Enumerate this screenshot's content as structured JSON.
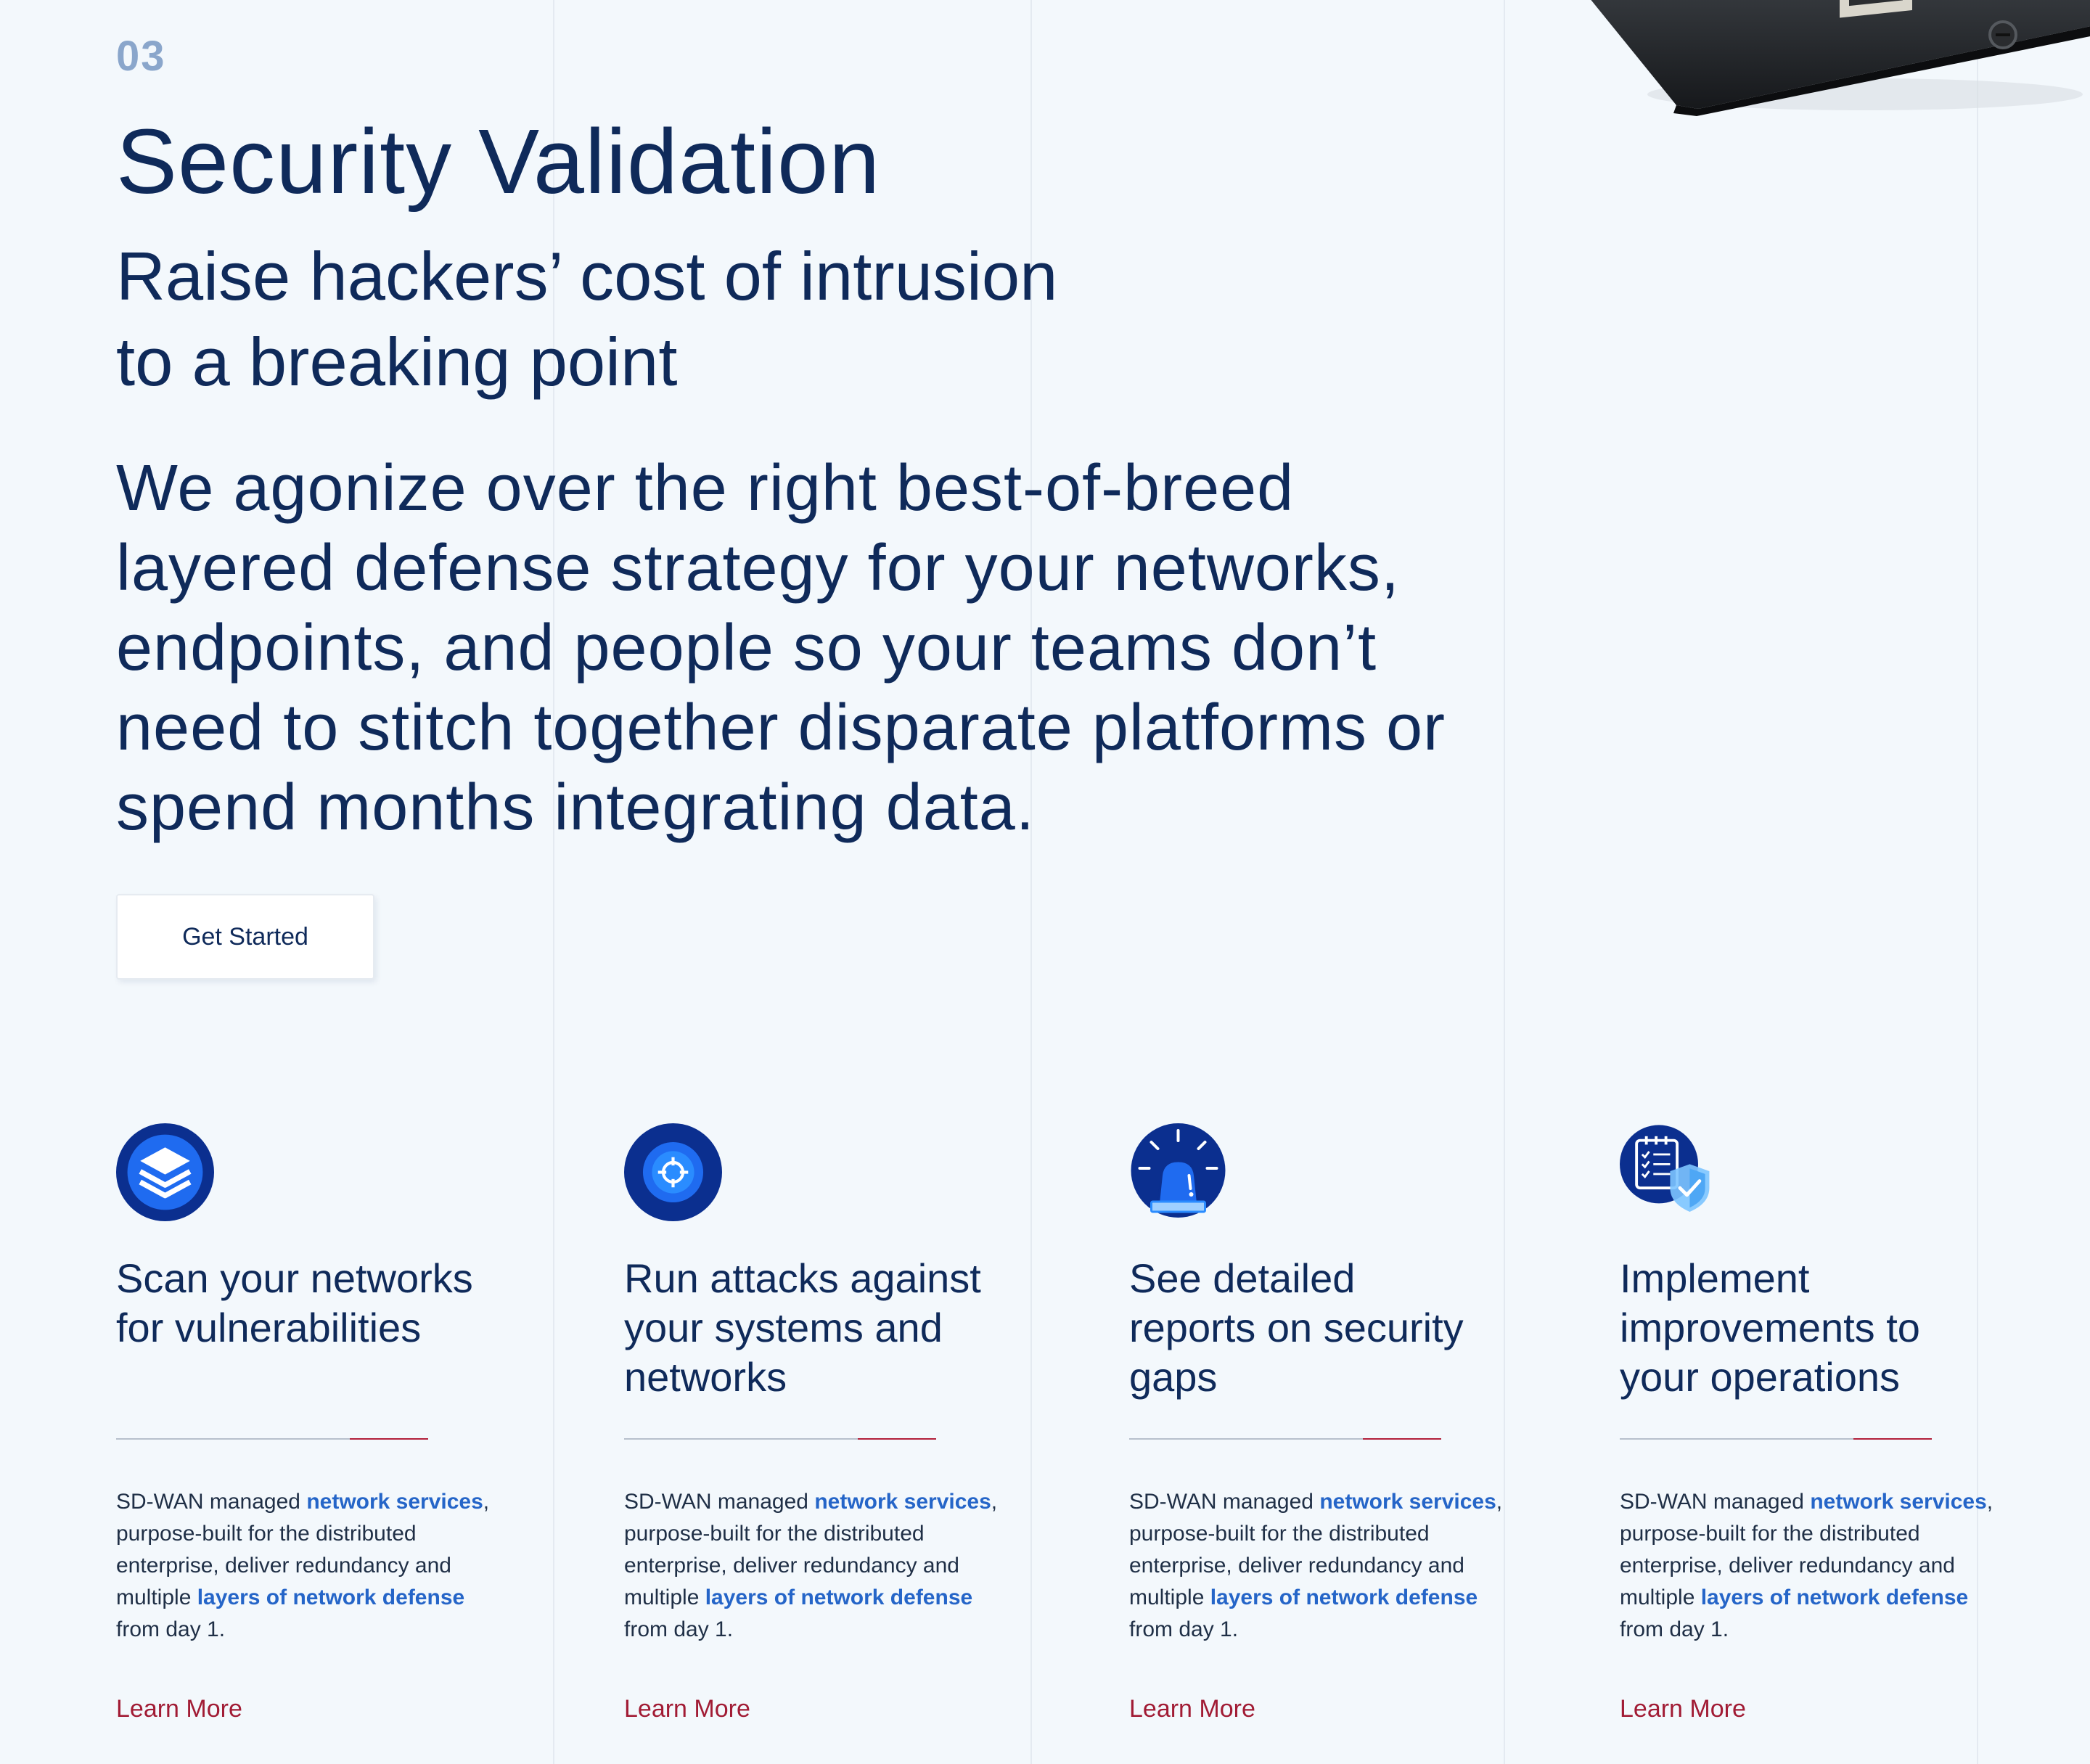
{
  "section": {
    "number": "03",
    "title": "Security Validation",
    "subtitle_lines": [
      "Raise hackers’ cost of intrusion",
      "to a breaking point"
    ],
    "body_lines": [
      "We agonize over the right best-of-breed",
      "layered defense strategy for your networks,",
      "endpoints, and people so your teams don’t",
      "need to stitch together disparate platforms or",
      "spend months integrating data."
    ],
    "cta_label": "Get Started"
  },
  "features": [
    {
      "icon": "layers-icon",
      "title_lines": [
        "Scan your networks",
        "for vulnerabilities"
      ],
      "desc": {
        "p1": "SD-WAN managed ",
        "hl1": "network services",
        "p2": ", purpose-built for the distributed enterprise, deliver redundancy and multiple ",
        "hl2": "layers of network defense",
        "p3": " from day 1."
      },
      "link": "Learn More"
    },
    {
      "icon": "target-icon",
      "title_lines": [
        "Run attacks against",
        "your systems and",
        "networks"
      ],
      "desc": {
        "p1": "SD-WAN managed ",
        "hl1": "network services",
        "p2": ", purpose-built for the distributed enterprise, deliver redundancy and multiple ",
        "hl2": "layers of network defense",
        "p3": " from day 1."
      },
      "link": "Learn More"
    },
    {
      "icon": "alarm-siren-icon",
      "title_lines": [
        "See detailed",
        "reports on security",
        "gaps"
      ],
      "desc": {
        "p1": "SD-WAN managed ",
        "hl1": "network services",
        "p2": ", purpose-built for the distributed enterprise, deliver redundancy and multiple ",
        "hl2": "layers of network defense",
        "p3": " from day 1."
      },
      "link": "Learn More"
    },
    {
      "icon": "checklist-shield-icon",
      "title_lines": [
        "Implement",
        "improvements to",
        "your operations"
      ],
      "desc": {
        "p1": "SD-WAN managed ",
        "hl1": "network services",
        "p2": ", purpose-built for the distributed enterprise, deliver redundancy and multiple ",
        "hl2": "layers of network defense",
        "p3": " from day 1."
      },
      "link": "Learn More"
    }
  ],
  "colors": {
    "background": "#f3f8fc",
    "heading": "#0f2a5a",
    "section_number": "#8aa6cb",
    "highlight": "#2565c8",
    "link": "#a11b34",
    "rule_accent": "#b21f3a",
    "icon_dark": "#0b2f8f",
    "icon_bright": "#1f6bf0"
  }
}
